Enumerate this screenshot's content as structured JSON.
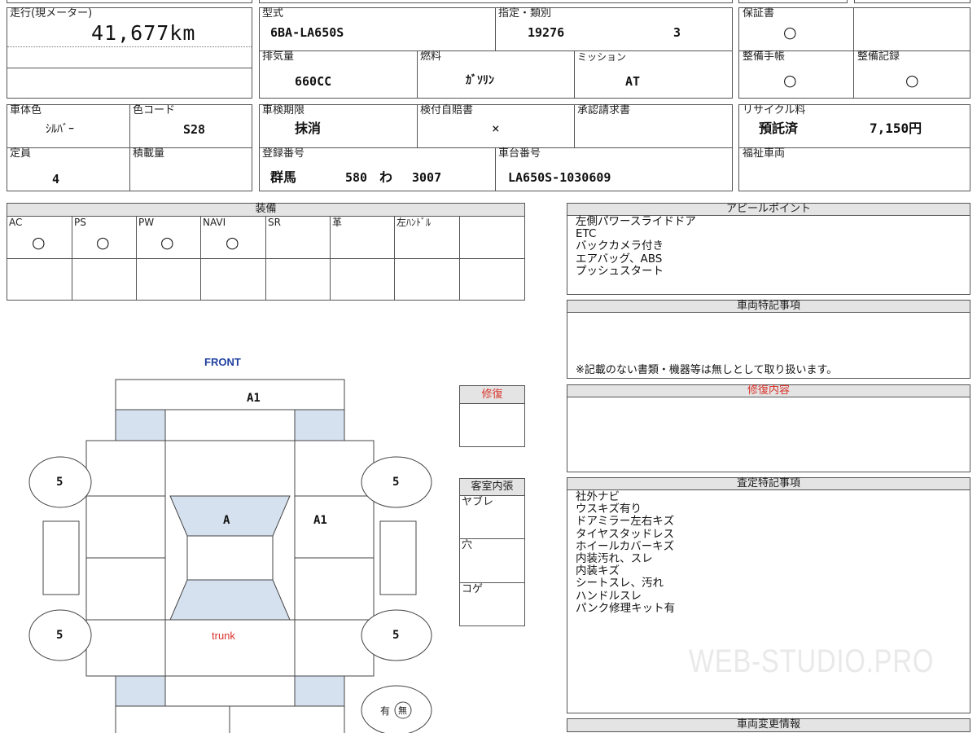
{
  "mileage": {
    "label": "走行(現メーター)",
    "value": "41,677km"
  },
  "model": {
    "label": "型式",
    "value": "6BA-LA650S"
  },
  "designation": {
    "label": "指定・類別",
    "number": "19276",
    "class": "3"
  },
  "warranty": {
    "label": "保証書",
    "value": "○"
  },
  "displacement": {
    "label": "排気量",
    "value": "660CC"
  },
  "fuel": {
    "label": "燃料",
    "value": "ｶﾞｿﾘﾝ"
  },
  "transmission": {
    "label": "ミッション",
    "value": "AT"
  },
  "maintenance_book": {
    "label": "整備手帳",
    "value": "○"
  },
  "maintenance_record": {
    "label": "整備記録",
    "value": "○"
  },
  "body_color": {
    "label": "車体色",
    "value": "ｼﾙﾊﾞｰ"
  },
  "color_code": {
    "label": "色コード",
    "value": "S28"
  },
  "inspection_expiry": {
    "label": "車検期限",
    "value": "抹消"
  },
  "insurance": {
    "label": "検付自賠書",
    "value": "×"
  },
  "approval_request": {
    "label": "承認請求書",
    "value": ""
  },
  "recycle": {
    "label": "リサイクル料",
    "status": "預託済",
    "amount": "7,150円"
  },
  "capacity": {
    "label": "定員",
    "value": "4"
  },
  "load_capacity": {
    "label": "積載量",
    "value": ""
  },
  "registration": {
    "label": "登録番号",
    "region": "群馬",
    "class_no": "580",
    "kana": "わ",
    "number": "3007"
  },
  "chassis": {
    "label": "車台番号",
    "value": "LA650S-1030609"
  },
  "welfare": {
    "label": "福祉車両",
    "value": ""
  },
  "equipment": {
    "title": "装備",
    "items": [
      {
        "label": "AC",
        "value": "○"
      },
      {
        "label": "PS",
        "value": "○"
      },
      {
        "label": "PW",
        "value": "○"
      },
      {
        "label": "NAVI",
        "value": "○"
      },
      {
        "label": "SR",
        "value": ""
      },
      {
        "label": "革",
        "value": ""
      },
      {
        "label": "左ﾊﾝﾄﾞﾙ",
        "value": ""
      },
      {
        "label": "",
        "value": ""
      }
    ]
  },
  "appeal": {
    "title": "アピールポイント",
    "lines": "左側パワースライドドア\nETC\nバックカメラ付き\nエアバッグ、ABS\nプッシュスタート"
  },
  "special_notes": {
    "title": "車両特記事項",
    "note": "※記載のない書類・機器等は無しとして取り扱います。"
  },
  "repair_content": {
    "title": "修復内容"
  },
  "inspection_notes": {
    "title": "査定特記事項",
    "lines": "社外ナビ\nウスキズ有り\nドアミラー左右キズ\nタイヤスタッドレス\nホイールカバーキズ\n内装汚れ、スレ\n内装キズ\nシートスレ、汚れ\nハンドルスレ\nパンク修理キット有"
  },
  "change_info": {
    "title": "車両変更情報"
  },
  "repair": {
    "title": "修復"
  },
  "interior": {
    "title": "客室内張",
    "rows": [
      "ヤブレ",
      "穴",
      "コゲ"
    ]
  },
  "diagram": {
    "front": "FRONT",
    "trunk": "trunk",
    "front_bumper": "A1",
    "hood": "A",
    "right_front_door": "A1",
    "tire_fl": "5",
    "tire_fr": "5",
    "tire_rl": "5",
    "tire_rr": "5",
    "presence": "有",
    "absence": "無"
  },
  "watermark": "WEB-STUDIO.PRO",
  "colors": {
    "panel_fill": "#d6e1ef",
    "header_fill": "#e4e4e4",
    "red": "#d9342b",
    "front_blue": "#1f3f9e"
  }
}
